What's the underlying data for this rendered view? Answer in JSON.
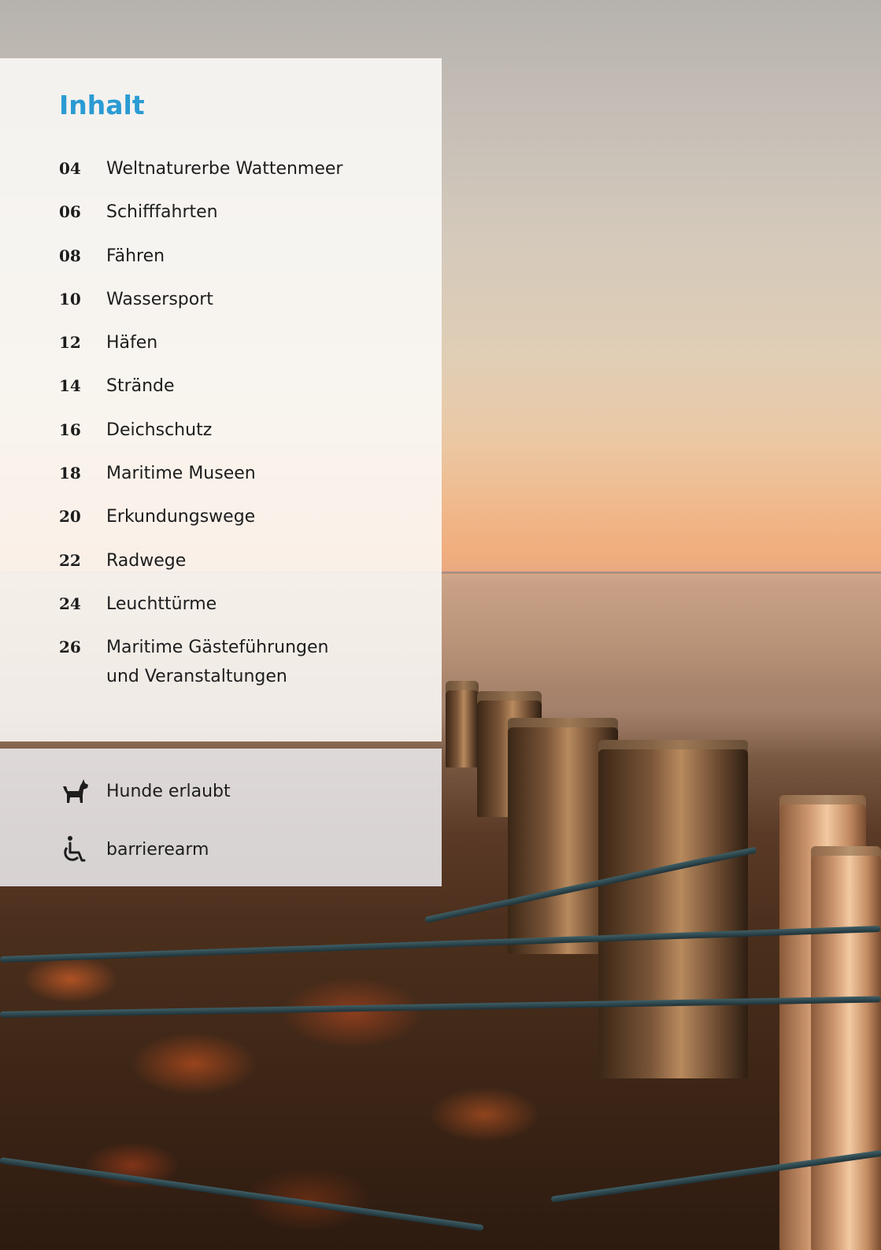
{
  "toc": {
    "title": "Inhalt",
    "items": [
      {
        "page": "04",
        "label": "Weltnaturerbe Wattenmeer"
      },
      {
        "page": "06",
        "label": "Schifffahrten"
      },
      {
        "page": "08",
        "label": "Fähren"
      },
      {
        "page": "10",
        "label": "Wassersport"
      },
      {
        "page": "12",
        "label": "Häfen"
      },
      {
        "page": "14",
        "label": "Strände"
      },
      {
        "page": "16",
        "label": "Deichschutz"
      },
      {
        "page": "18",
        "label": "Maritime Museen"
      },
      {
        "page": "20",
        "label": "Erkundungswege"
      },
      {
        "page": "22",
        "label": "Radwege"
      },
      {
        "page": "24",
        "label": "Leuchttürme"
      },
      {
        "page": "26",
        "label": "Maritime Gästeführungen\nund Veranstaltungen"
      }
    ]
  },
  "legend": {
    "items": [
      {
        "icon": "dog-icon",
        "label": "Hunde erlaubt"
      },
      {
        "icon": "wheelchair-icon",
        "label": "barrierearm"
      }
    ]
  },
  "colors": {
    "heading": "#2a9bd3",
    "text": "#1d1d1d"
  }
}
